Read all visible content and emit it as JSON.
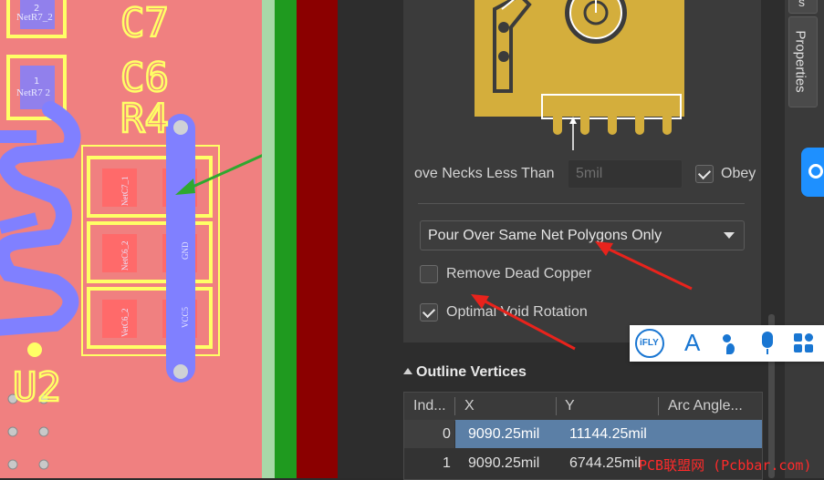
{
  "pcb": {
    "designators": {
      "c7": "C7",
      "c6": "C6",
      "r4": "R4",
      "u2": "U2"
    },
    "nets": {
      "netr7_2_top": "NetR7_2",
      "netr7_2_bottom": "NetR7 2",
      "netc7_1": "NetC7_1",
      "netc6_2": "NetC6_2",
      "gnd": "GND",
      "vcc5": "VCC5",
      "vcc6": "VetC6_2"
    },
    "pad_numbers": {
      "n1": "1",
      "n2": "2"
    }
  },
  "polygon_panel": {
    "remove_necks_label": "ove Necks Less Than",
    "remove_necks_value": "5mil",
    "obey_label": "Obey",
    "obey_checked": true,
    "pour_mode_selected": "Pour Over Same Net Polygons Only",
    "remove_dead_copper_label": "Remove Dead Copper",
    "remove_dead_copper_checked": false,
    "optimal_void_rotation_label": "Optimal Void Rotation",
    "optimal_void_rotation_checked": true
  },
  "outline_vertices": {
    "section_title": "Outline Vertices",
    "columns": [
      "Ind...",
      "X",
      "Y",
      "Arc Angle..."
    ],
    "rows": [
      {
        "index": "0",
        "x": "9090.25mil",
        "y": "11144.25mil",
        "arc": ""
      },
      {
        "index": "1",
        "x": "9090.25mil",
        "y": "6744.25mil",
        "arc": ""
      }
    ]
  },
  "right_tabs": {
    "partial_tab": "s",
    "properties_tab": "Properties"
  },
  "ifly_toolbar": {
    "logo_text": "iFLY",
    "font_glyph": "A"
  },
  "watermark": "PCB联盟网 (Pcbbar.com)",
  "colors": {
    "board_red": "#f08080",
    "pad_yellow": "#ffff66",
    "trace_blue": "#8080ff",
    "accent_green": "#22aa22",
    "dark_red": "#8b0000",
    "selection_blue": "#5b7fa6",
    "arrow_red": "#e8231c",
    "arrow_green": "#2fa82f"
  }
}
